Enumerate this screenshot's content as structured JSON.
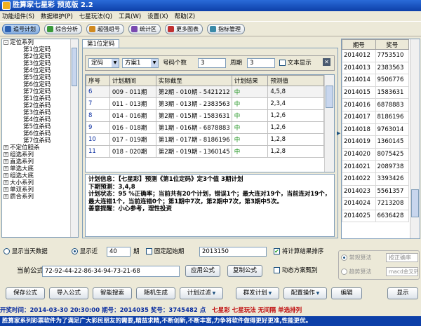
{
  "app": {
    "title": "胜算家七星彩  预览版  2.2"
  },
  "menu": [
    "功能组件(S)",
    "数据维护(P)",
    "七星玩法(Q)",
    "工具(W)",
    "设置(X)",
    "帮助(Z)"
  ],
  "toolbar": [
    {
      "label": "追号计划",
      "color": "#2a5fb0"
    },
    {
      "label": "综合分析",
      "color": "#3a9a3a"
    },
    {
      "label": "超强组号",
      "color": "#d08a20"
    },
    {
      "label": "统计区",
      "color": "#7a4ab0"
    },
    {
      "label": "更多图表",
      "color": "#c03030"
    },
    {
      "label": "指标管理",
      "color": "#3a8aa8"
    }
  ],
  "tree": [
    {
      "label": "定位系列",
      "level": 0,
      "expand": "-"
    },
    {
      "label": "第1位定码",
      "level": 1
    },
    {
      "label": "第2位定码",
      "level": 1
    },
    {
      "label": "第3位定码",
      "level": 1
    },
    {
      "label": "第4位定码",
      "level": 1
    },
    {
      "label": "第5位定码",
      "level": 1
    },
    {
      "label": "第6位定码",
      "level": 1
    },
    {
      "label": "第7位定码",
      "level": 1
    },
    {
      "label": "第1位杀码",
      "level": 1
    },
    {
      "label": "第2位杀码",
      "level": 1
    },
    {
      "label": "第3位杀码",
      "level": 1
    },
    {
      "label": "第4位杀码",
      "level": 1
    },
    {
      "label": "第5位杀码",
      "level": 1
    },
    {
      "label": "第6位杀码",
      "level": 1
    },
    {
      "label": "第7位杀码",
      "level": 1
    },
    {
      "label": "不定位胆杀",
      "level": 0,
      "expand": "+"
    },
    {
      "label": "组选系列",
      "level": 0,
      "expand": "+"
    },
    {
      "label": "直选系列",
      "level": 0,
      "expand": "+"
    },
    {
      "label": "单选大底",
      "level": 0,
      "expand": "+"
    },
    {
      "label": "组选大底",
      "level": 0,
      "expand": "+"
    },
    {
      "label": "大小系列",
      "level": 0,
      "expand": "+"
    },
    {
      "label": "单双系列",
      "level": 0,
      "expand": "+"
    },
    {
      "label": "质合系列",
      "level": 0,
      "expand": "+"
    }
  ],
  "tab": {
    "label": "第1位定码"
  },
  "controls": {
    "type_value": "定码",
    "scheme_value": "方案1",
    "count_label": "号码个数",
    "count_value": "3",
    "period_label": "周期",
    "period_value": "3",
    "text_show_label": "文本显示"
  },
  "grid": {
    "headers": [
      "序号",
      "计划期间",
      "实际截至",
      "计划结果",
      "预测值"
    ],
    "rows": [
      [
        "6",
        "009 - 011期",
        "第2期 - 010期 - 5421212",
        "中",
        "4,5,8"
      ],
      [
        "7",
        "011 - 013期",
        "第3期 - 013期 - 2383563",
        "中",
        "2,3,4"
      ],
      [
        "8",
        "014 - 016期",
        "第2期 - 015期 - 1583631",
        "中",
        "1,2,6"
      ],
      [
        "9",
        "016 - 018期",
        "第1期 - 016期 - 6878883",
        "中",
        "1,2,6"
      ],
      [
        "10",
        "017 - 019期",
        "第1期 - 017期 - 8186196",
        "中",
        "1,2,8"
      ],
      [
        "11",
        "018 - 020期",
        "第2期 - 019期 - 1360145",
        "中",
        "1,2,8"
      ]
    ]
  },
  "info": {
    "lines": [
      "计划信息：【七星彩】预测《第1位定码》定3个值 3期计划",
      "下期预测：3,4,8",
      "计划状态：95 %正确率；当前共有20个计划，错误1个；最大连对19个，当前连对19个，最大连错1个，当前连错0个；第1期中7次，第2期中7次，第3期中5次。",
      "善意提醒：小心参考，理性投资"
    ]
  },
  "history": {
    "headers": [
      "期号",
      "奖号"
    ],
    "rows": [
      [
        "2014012",
        "7753510"
      ],
      [
        "2014013",
        "2383563"
      ],
      [
        "2014014",
        "9506776"
      ],
      [
        "2014015",
        "1583631"
      ],
      [
        "2014016",
        "6878883"
      ],
      [
        "2014017",
        "8186196"
      ],
      [
        "2014018",
        "9763014"
      ],
      [
        "2014019",
        "1360145"
      ],
      [
        "2014020",
        "8075425"
      ],
      [
        "2014021",
        "2089738"
      ],
      [
        "2014022",
        "3393426"
      ],
      [
        "2014023",
        "5561357"
      ],
      [
        "2014024",
        "7213208"
      ],
      [
        "2014025",
        "6636428"
      ]
    ]
  },
  "options": {
    "today_label": "显示当天数据",
    "recent_label": "显示近",
    "recent_value": "40",
    "period_unit": "期",
    "fix_start_label": "固定起始期",
    "start_value": "2013150",
    "sort_label": "将计算结果排序"
  },
  "formula": {
    "label": "当前公式",
    "value": "72-92-44-22-86-34-94-73-21-68",
    "apply_label": "应用公式",
    "copy_label": "复制公式",
    "dynamic_label": "动态方案甄别"
  },
  "algo": {
    "normal_label": "常规算法",
    "trend_label": "趋势算法",
    "rate_value": "按正确率",
    "md5_value": "macd金叉转"
  },
  "buttons": [
    "保存公式",
    "导入公式",
    "智能搜索",
    "随机生成",
    "计划过滤",
    "群发计划",
    "配置操作",
    "编辑",
    "显示"
  ],
  "status": {
    "text": "开奖时间：2014-03-30 20:30:00  期号：2014035  奖号：3745482  点",
    "brand": "七星彩  七星玩法  无间隔  单选排列"
  },
  "ticker": {
    "text": "胜算家系列彩票软件为了满足广大彩民朋友的需要,精益求精,不断创新,不断丰富,力争将软件做得更好更准,性能更优。"
  }
}
